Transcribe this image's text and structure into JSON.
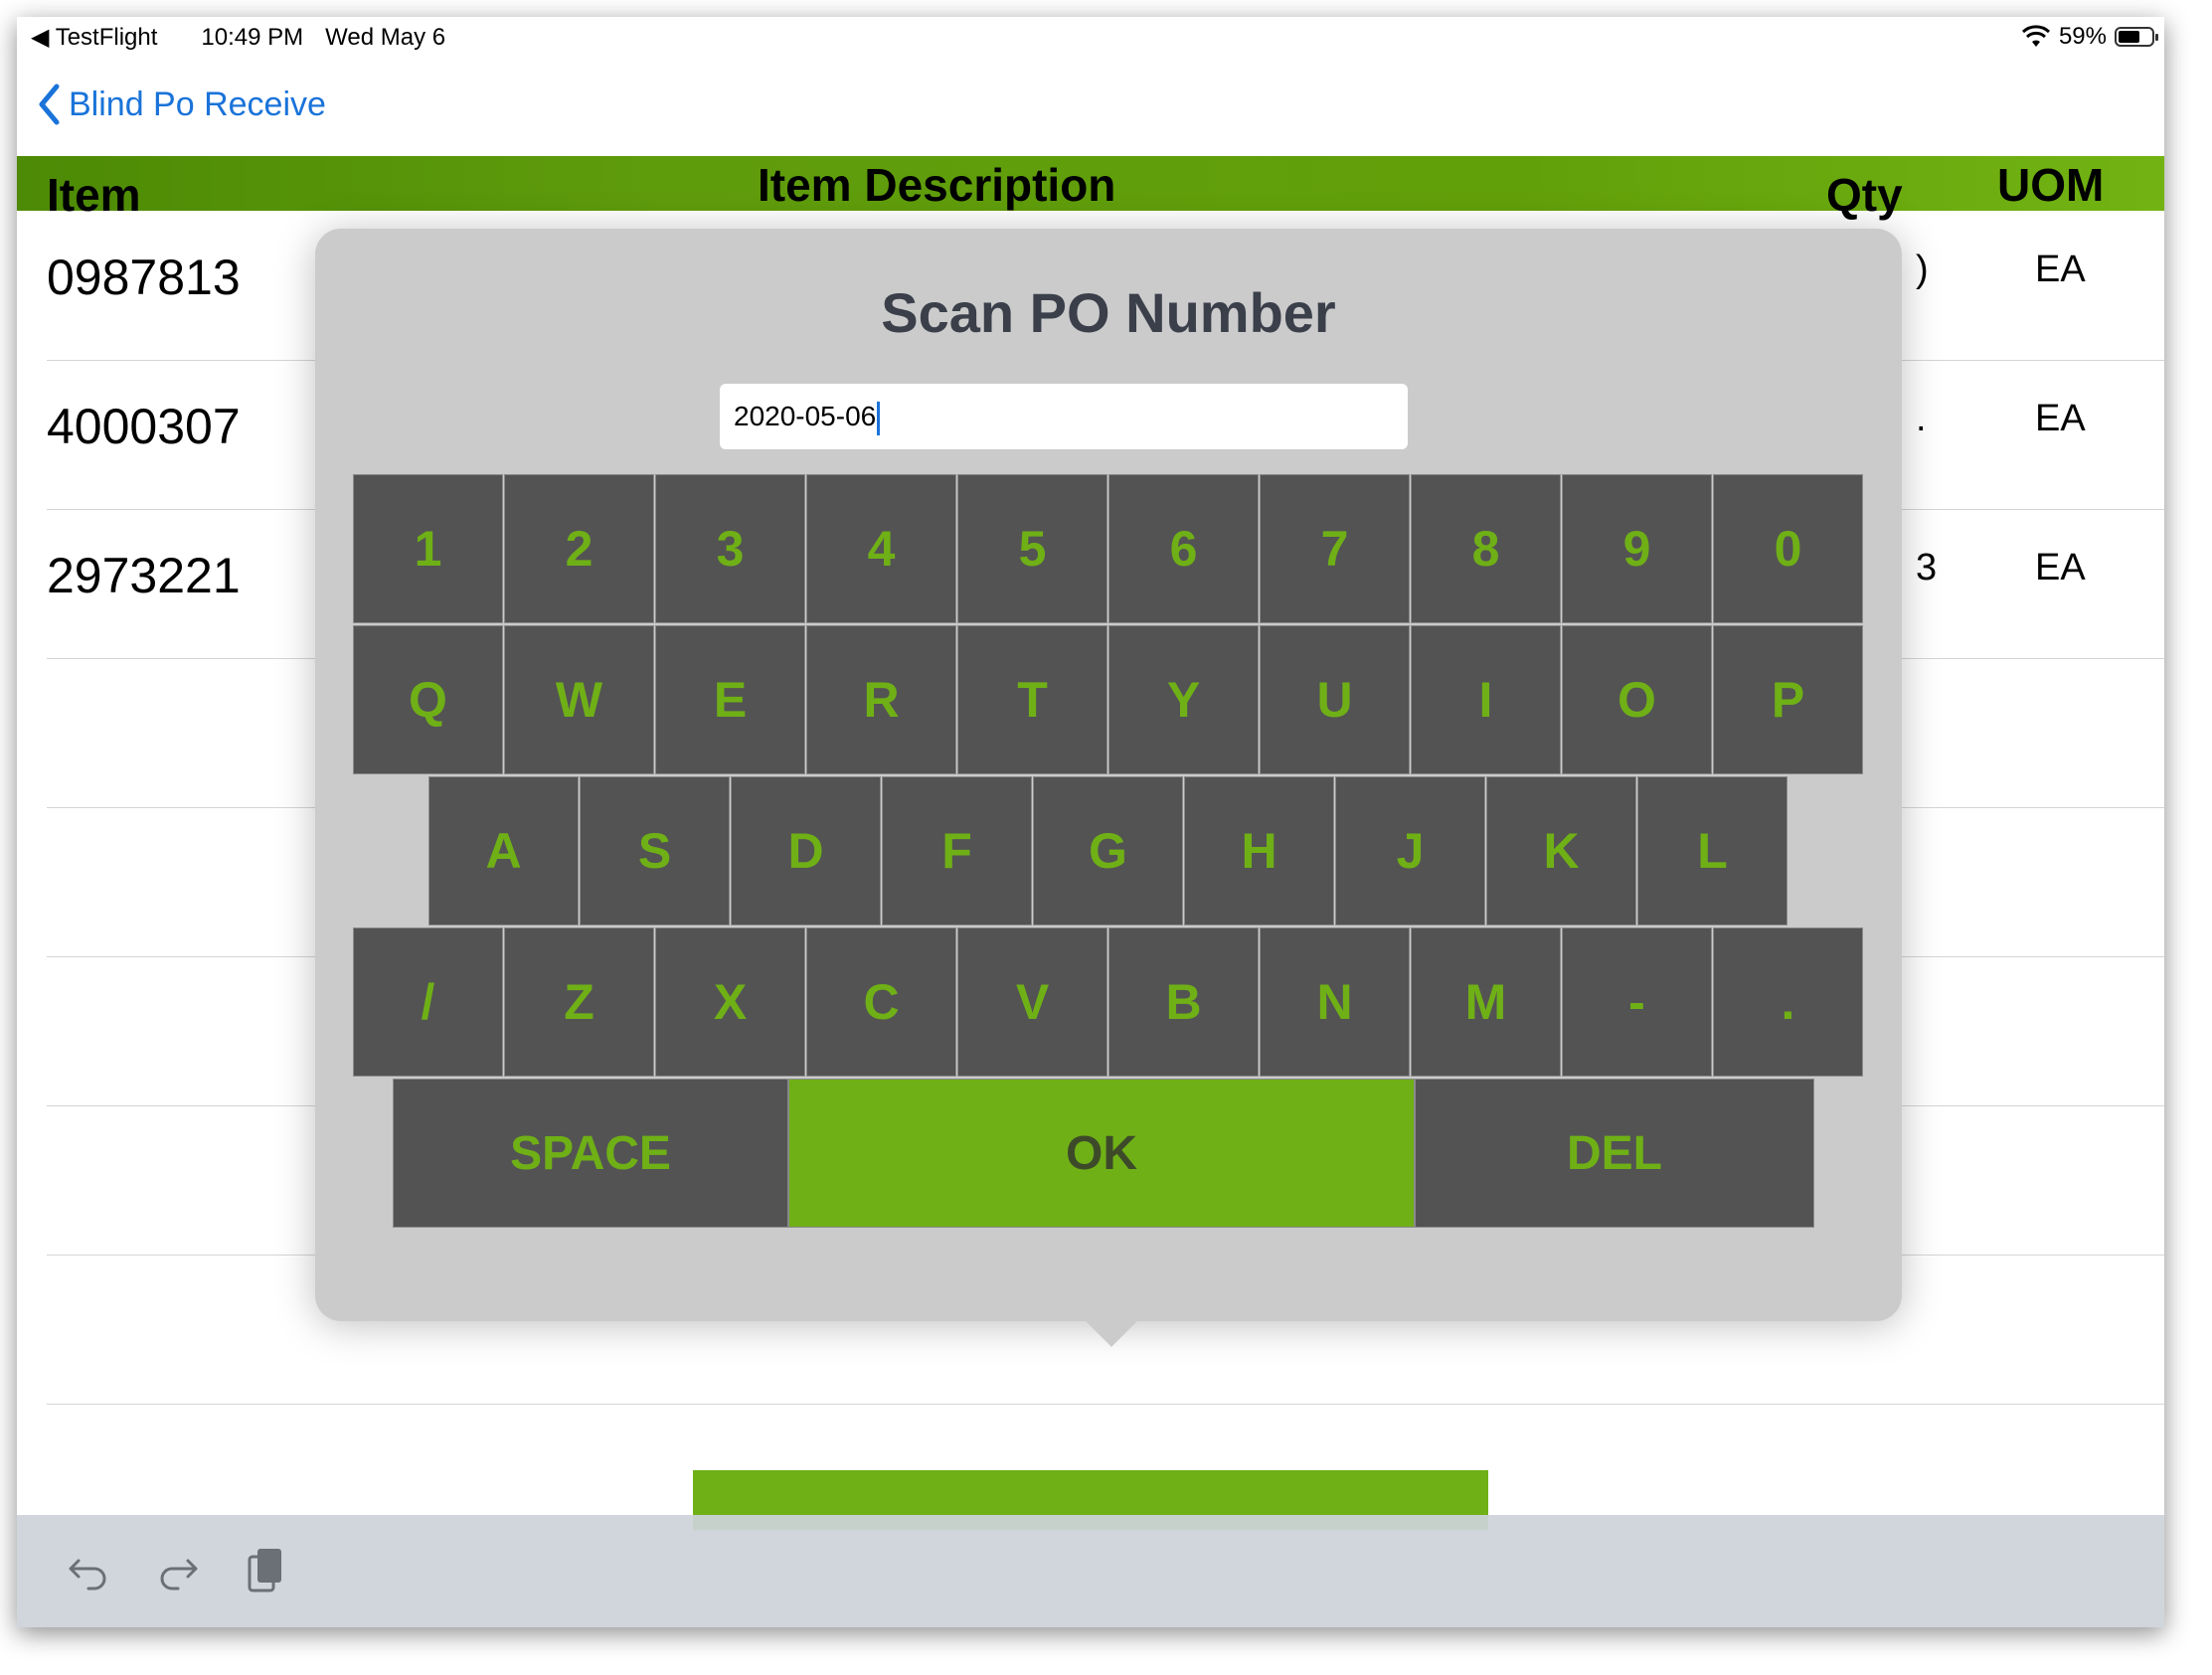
{
  "status_bar": {
    "app": "TestFlight",
    "time": "10:49 PM",
    "date": "Wed May 6",
    "battery": "59%"
  },
  "nav": {
    "back_label": "Blind Po Receive"
  },
  "table": {
    "headers": {
      "item": "Item",
      "description": "Item Description",
      "qty": "Qty",
      "uom": "UOM"
    },
    "rows": [
      {
        "item": "0987813",
        "qty_partial": ")",
        "uom": "EA"
      },
      {
        "item": "4000307",
        "qty_partial": ".",
        "uom": "EA"
      },
      {
        "item": "2973221",
        "qty_partial": "3",
        "uom": "EA"
      }
    ]
  },
  "dialog": {
    "title": "Scan PO Number",
    "input_value": "2020-05-06",
    "keys": {
      "row1": [
        "1",
        "2",
        "3",
        "4",
        "5",
        "6",
        "7",
        "8",
        "9",
        "0"
      ],
      "row2": [
        "Q",
        "W",
        "E",
        "R",
        "T",
        "Y",
        "U",
        "I",
        "O",
        "P"
      ],
      "row3": [
        "A",
        "S",
        "D",
        "F",
        "G",
        "H",
        "J",
        "K",
        "L"
      ],
      "row4": [
        "/",
        "Z",
        "X",
        "C",
        "V",
        "B",
        "N",
        "M",
        "-",
        "."
      ],
      "space": "SPACE",
      "ok": "OK",
      "del": "DEL"
    }
  },
  "colors": {
    "accent_green": "#6fb016",
    "key_bg": "#535353",
    "link_blue": "#1a73d9",
    "dialog_bg": "#cbcbcb"
  },
  "toolbar": {
    "icons": [
      "undo-icon",
      "redo-icon",
      "clipboard-icon"
    ]
  }
}
